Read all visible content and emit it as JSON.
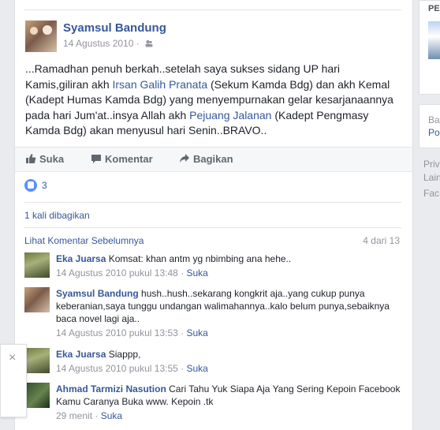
{
  "post": {
    "author": "Syamsul Bandung",
    "date": "14 Agustus 2010",
    "meta_sep": "·",
    "text": {
      "p1": "...Ramadhan penuh berkah..setelah saya sukses sidang UP hari Kamis,giliran akh ",
      "link1": "Irsan Galih Pranata",
      "p2": " (Sekum Kamda Bdg) dan akh Kemal (Kadept Humas Kamda Bdg) yang menyempurnakan gelar kesarjanaannya pada hari Jum'at..insya Allah akh ",
      "link2": "Pejuang Jalanan",
      "p3": " (Kadept Pengmasy Kamda Bdg) akan menyusul hari Senin..BRAVO.."
    },
    "actions": {
      "like": "Suka",
      "comment": "Komentar",
      "share": "Bagikan"
    },
    "reactions": {
      "count": "3",
      "icon": "like-thumb-icon",
      "color": "#5890ff"
    },
    "shares": "1 kali dibagikan"
  },
  "comments_section": {
    "view_previous": "Lihat Komentar Sebelumnya",
    "count": "4 dari 13",
    "items": [
      {
        "name": "Eka Juarsa",
        "text": "Komsat: khan antm yg nbimbing ana hehe..",
        "time": "14 Agustus 2010 pukul 13:48",
        "action": "Suka"
      },
      {
        "name": "Syamsul Bandung",
        "text": "hush..hush..sekarang kongkrit aja..yang cukup punya keberanian,saya tunggu undangan walimahannya..kalo belum punya,sebaiknya baca novel lagi aja..",
        "time": "14 Agustus 2010 pukul 13:53",
        "action": "Suka"
      },
      {
        "name": "Eka Juarsa",
        "text": "Siappp,",
        "time": "14 Agustus 2010 pukul 13:55",
        "action": "Suka"
      },
      {
        "name": "Ahmad Tarmizi Nasution",
        "text": "Cari Tahu Yuk Siapa Aja Yang Sering Kepoin Facebook Kamu Caranya Buka www. Kepoin .tk",
        "time": "29 menit",
        "action": "Suka"
      }
    ],
    "time_sep": " · "
  },
  "right_rail": {
    "box1_title": "PE",
    "box2_line1": "Ba",
    "box2_line2": "Po",
    "footer": [
      "Priv",
      "Lain",
      "Fac"
    ]
  },
  "chat": {
    "close": "×"
  },
  "colors": {
    "link": "#365899",
    "muted": "#90949c",
    "background": "#e9ebee"
  }
}
